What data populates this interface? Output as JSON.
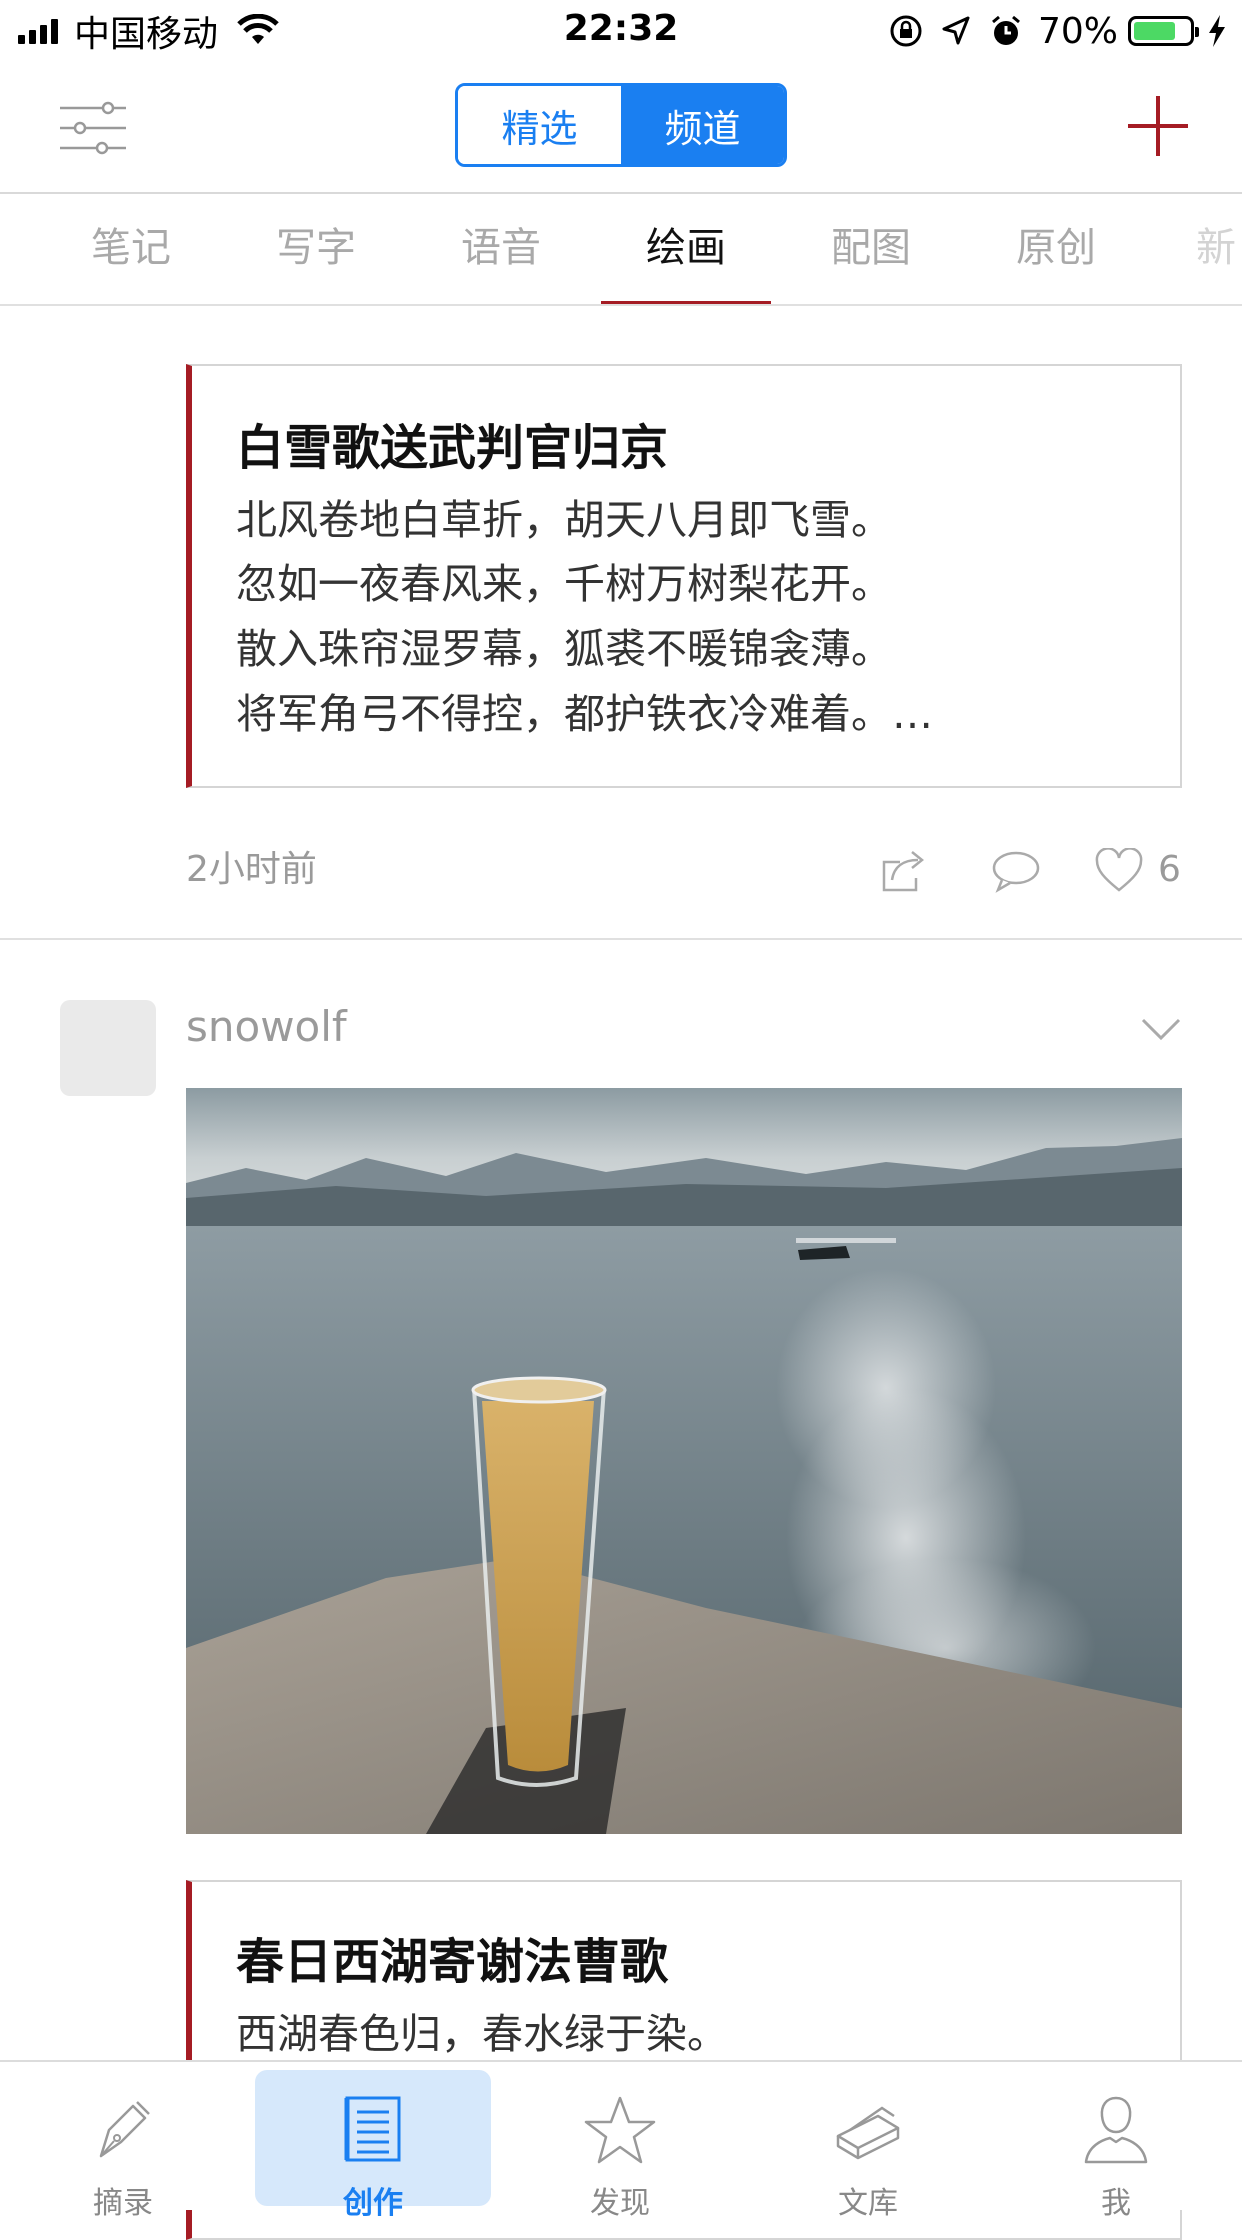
{
  "status_bar": {
    "carrier": "中国移动",
    "time": "22:32",
    "battery": "70%"
  },
  "nav": {
    "segments": [
      "精选",
      "频道"
    ],
    "active_segment": "频道"
  },
  "channels": {
    "items": [
      "笔记",
      "写字",
      "语音",
      "绘画",
      "配图",
      "原创",
      "新"
    ],
    "active": "绘画"
  },
  "post1": {
    "title": "白雪歌送武判官归京",
    "lines": [
      "北风卷地白草折，胡天八月即飞雪。",
      "忽如一夜春风来，千树万树梨花开。",
      "散入珠帘湿罗幕，狐裘不暖锦衾薄。",
      "将军角弓不得控，都护铁衣冷难着。…"
    ],
    "time": "2小时前",
    "likes": "6"
  },
  "post2": {
    "username": "snowolf",
    "title": "春日西湖寄谢法曹歌",
    "lines": [
      "西湖春色归，春水绿于染。"
    ]
  },
  "tabbar": {
    "items": [
      "摘录",
      "创作",
      "发现",
      "文库",
      "我"
    ],
    "active": "创作"
  },
  "colors": {
    "accent": "#1a7ff1",
    "brand_red": "#a51c24",
    "muted": "#9a9a9a"
  }
}
